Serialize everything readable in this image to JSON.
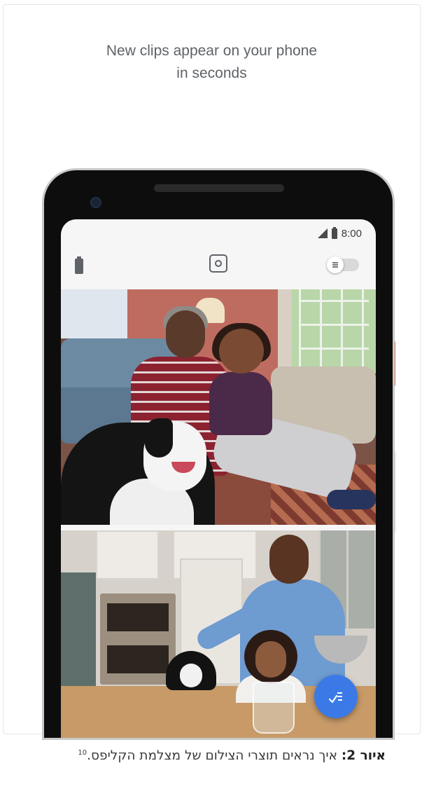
{
  "headline": {
    "line1": "New clips appear on your phone",
    "line2": "in seconds"
  },
  "status_bar": {
    "time": "8:00",
    "icons": [
      "cell-signal-icon",
      "battery-icon"
    ]
  },
  "app_bar": {
    "icons": [
      "battery-icon",
      "camera-icon",
      "toggle-switch-icon"
    ]
  },
  "clips": [
    {
      "scene": "living-room-family-with-dog"
    },
    {
      "scene": "kitchen-family-with-dog"
    }
  ],
  "fab": {
    "icon": "check-list-icon",
    "color": "#3b7ae6"
  },
  "caption": {
    "label": "איור 2:",
    "text": " איך נראים תוצרי הצילום של מצלמת הקליפס.",
    "footnote": "10"
  }
}
